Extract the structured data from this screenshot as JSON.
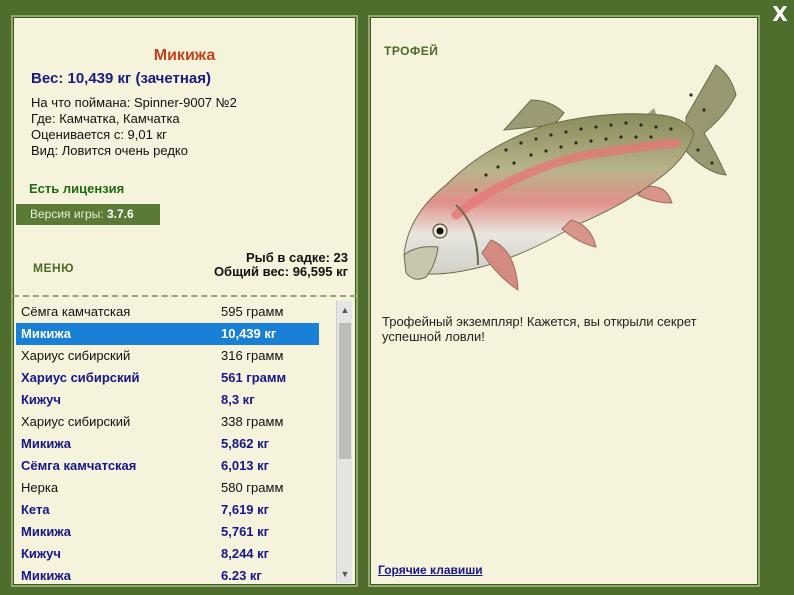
{
  "close_label": "X",
  "fish": {
    "title": "Микижа",
    "weight": "Вес: 10,439 кг (зачетная)",
    "caught_with": "На что поймана: Spinner-9007 №2",
    "where": "Где: Камчатка, Камчатка",
    "valued_from": "Оценивается с: 9,01 кг",
    "kind": "Вид: Ловится очень редко"
  },
  "license": "Есть лицензия",
  "version": {
    "label": "Версия игры: ",
    "value": "3.7.6"
  },
  "menu_label": "МЕНЮ",
  "cage": {
    "count": "Рыб в садке: 23",
    "total": "Общий вес: 96,595 кг"
  },
  "catch_list": [
    {
      "name": "Сёмга камчатская",
      "weight": "595 грамм",
      "style": "normal"
    },
    {
      "name": "Микижа",
      "weight": "10,439 кг",
      "style": "selected"
    },
    {
      "name": "Хариус сибирский",
      "weight": "316 грамм",
      "style": "normal"
    },
    {
      "name": "Хариус сибирский",
      "weight": "561 грамм",
      "style": "bold"
    },
    {
      "name": "Кижуч",
      "weight": "8,3 кг",
      "style": "bold"
    },
    {
      "name": "Хариус сибирский",
      "weight": "338 грамм",
      "style": "normal"
    },
    {
      "name": "Микижа",
      "weight": "5,862 кг",
      "style": "bold"
    },
    {
      "name": "Сёмга камчатская",
      "weight": "6,013 кг",
      "style": "bold"
    },
    {
      "name": "Нерка",
      "weight": "580 грамм",
      "style": "normal"
    },
    {
      "name": "Кета",
      "weight": "7,619 кг",
      "style": "bold"
    },
    {
      "name": "Микижа",
      "weight": "5,761 кг",
      "style": "bold"
    },
    {
      "name": "Кижуч",
      "weight": "8,244 кг",
      "style": "bold"
    },
    {
      "name": "Микижа",
      "weight": "6.23 кг",
      "style": "bold"
    }
  ],
  "trophy": {
    "label": "ТРОФЕЙ",
    "text": "Трофейный экземпляр! Кажется, вы открыли секрет успешной ловли!"
  },
  "hotkeys_label": "Горячие клавиши",
  "icons": {
    "close": "close-icon",
    "scroll_up": "scroll-up-icon",
    "scroll_down": "scroll-down-icon",
    "fish_picture": "rainbow-trout-image"
  }
}
